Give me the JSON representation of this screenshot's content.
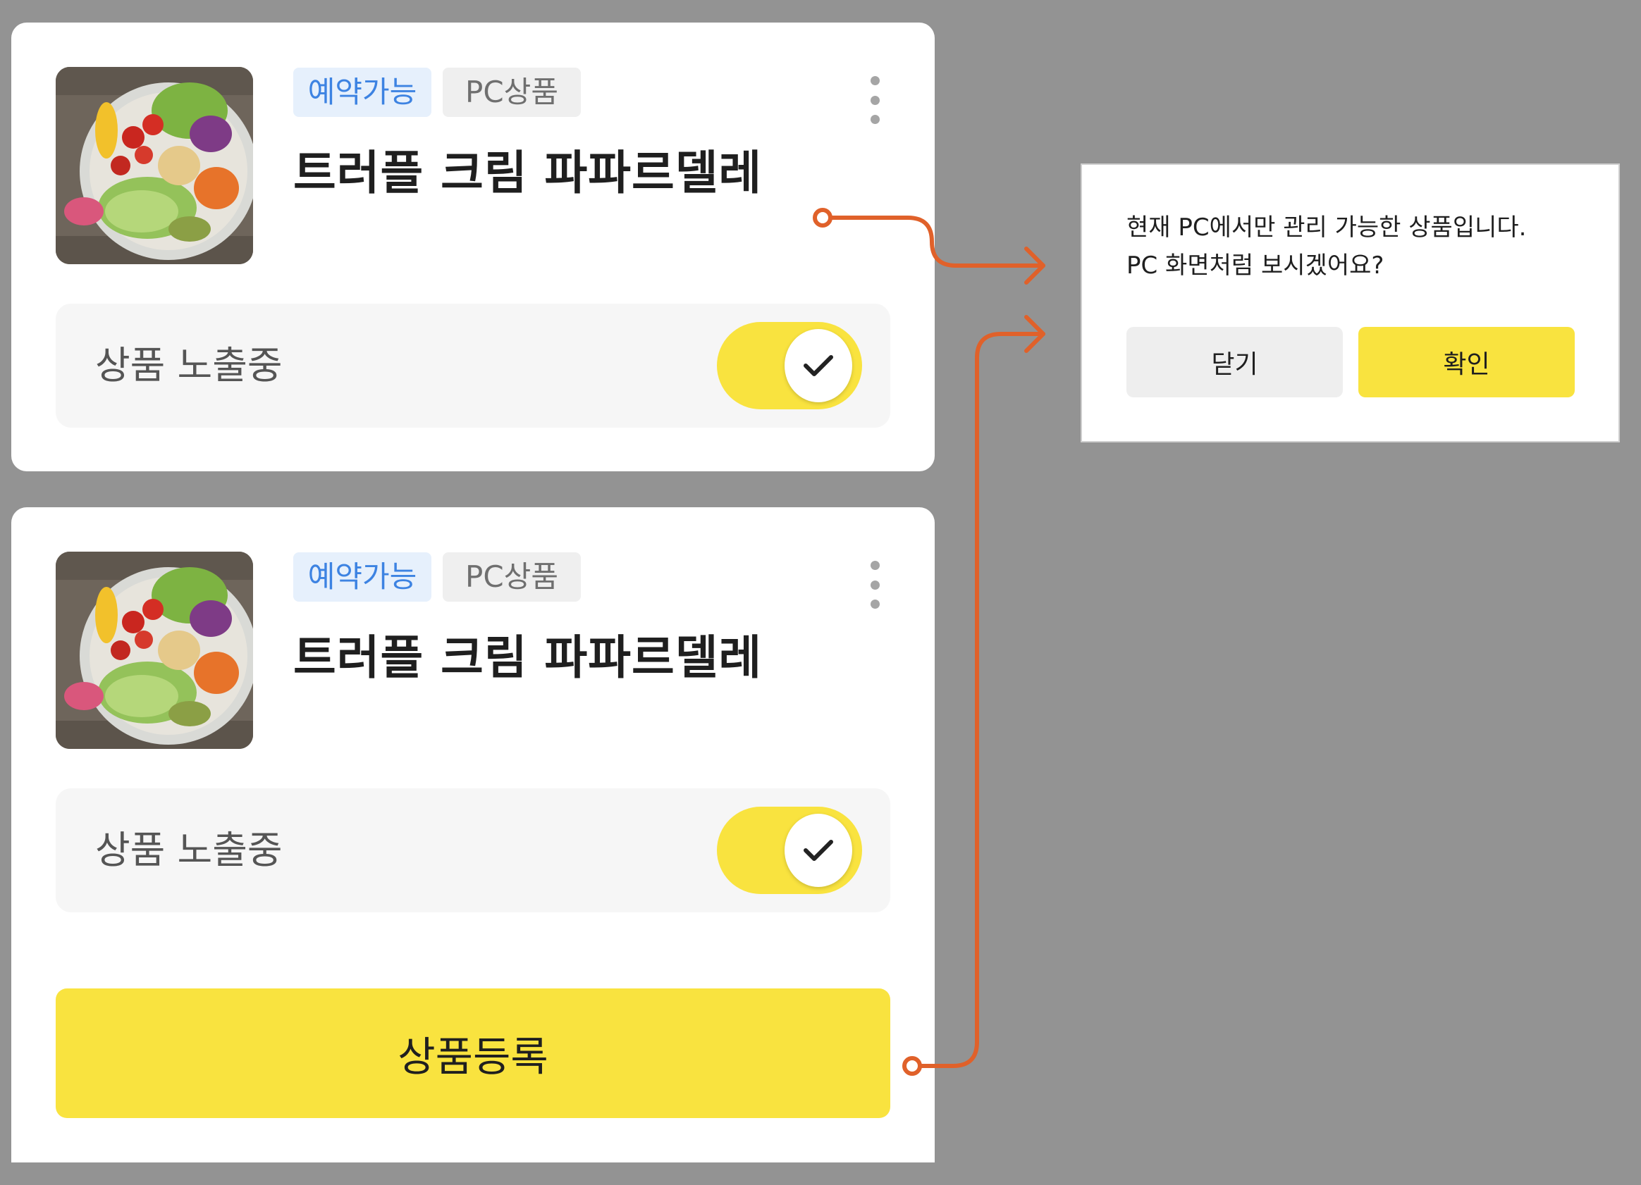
{
  "cards": [
    {
      "tags": {
        "reserve": "예약가능",
        "pc": "PC상품"
      },
      "title": "트러플 크림 파파르델레",
      "expose_label": "상품 노출중",
      "expose_on": true
    },
    {
      "tags": {
        "reserve": "예약가능",
        "pc": "PC상품"
      },
      "title": "트러플 크림 파파르델레",
      "expose_label": "상품 노출중",
      "expose_on": true,
      "register_label": "상품등록"
    }
  ],
  "dialog": {
    "message_line1": "현재 PC에서만 관리 가능한 상품입니다.",
    "message_line2": "PC 화면처럼 보시겠어요?",
    "close_label": "닫기",
    "confirm_label": "확인"
  },
  "colors": {
    "accent_yellow": "#f9e33f",
    "flow_arrow": "#e0612a",
    "tag_blue_text": "#3d83e2",
    "tag_blue_bg": "#e6f0fc"
  },
  "icons": [
    "food-bowl-image",
    "more-vertical-icon",
    "check-icon"
  ]
}
